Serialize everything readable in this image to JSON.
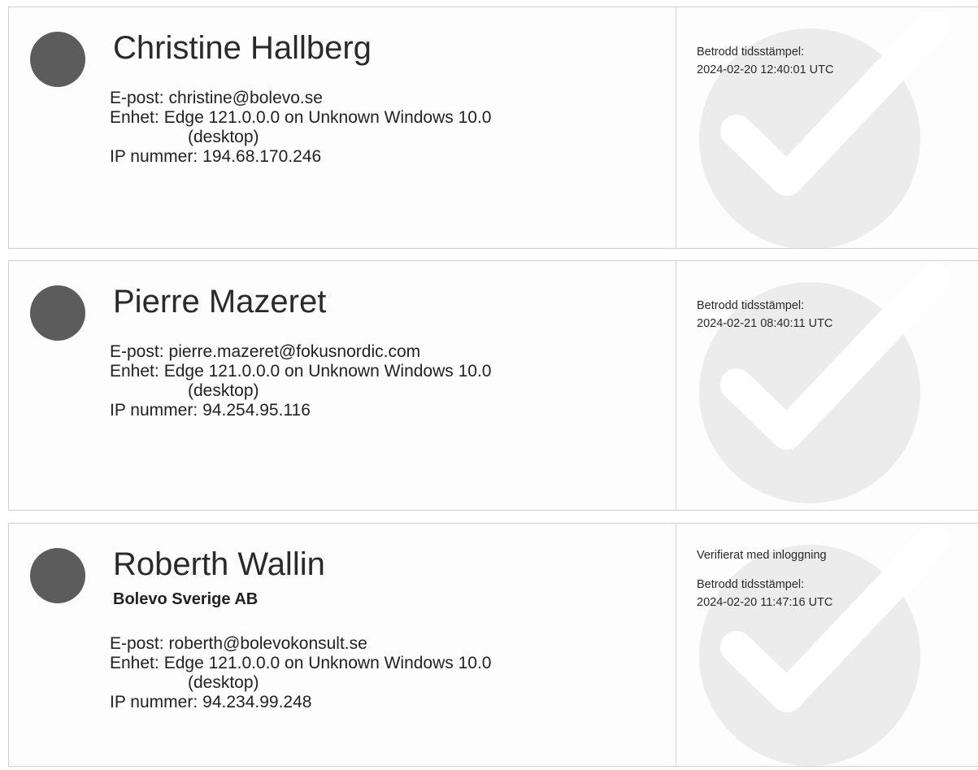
{
  "signers": [
    {
      "name": "Christine Hallberg",
      "email_label": "E-post:",
      "email": "christine@bolevo.se",
      "device_label": "Enhet:",
      "device_line1": "Edge 121.0.0.0 on Unknown Windows 10.0",
      "device_line2": "(desktop)",
      "ip_label": "IP nummer:",
      "ip": "194.68.170.246",
      "timestamp_label": "Betrodd tidsstämpel:",
      "timestamp": "2024-02-20 12:40:01 UTC"
    },
    {
      "name": "Pierre Mazeret",
      "email_label": "E-post:",
      "email": "pierre.mazeret@fokusnordic.com",
      "device_label": "Enhet:",
      "device_line1": "Edge 121.0.0.0 on Unknown Windows 10.0",
      "device_line2": "(desktop)",
      "ip_label": "IP nummer:",
      "ip": "94.254.95.116",
      "timestamp_label": "Betrodd tidsstämpel:",
      "timestamp": "2024-02-21 08:40:11 UTC"
    },
    {
      "name": "Roberth Wallin",
      "company": "Bolevo Sverige AB",
      "email_label": "E-post:",
      "email": "roberth@bolevokonsult.se",
      "device_label": "Enhet:",
      "device_line1": "Edge 121.0.0.0 on Unknown Windows 10.0",
      "device_line2": "(desktop)",
      "ip_label": "IP nummer:",
      "ip": "94.234.99.248",
      "verified_text": "Verifierat med inloggning",
      "timestamp_label": "Betrodd tidsstämpel:",
      "timestamp": "2024-02-20 11:47:16 UTC"
    }
  ],
  "icons": {
    "avatar": "avatar-circle",
    "watermark": "checkmark-icon"
  },
  "colors": {
    "avatar": "#5c5c5c",
    "watermark_circle": "#ececec",
    "watermark_check": "#ffffff"
  }
}
